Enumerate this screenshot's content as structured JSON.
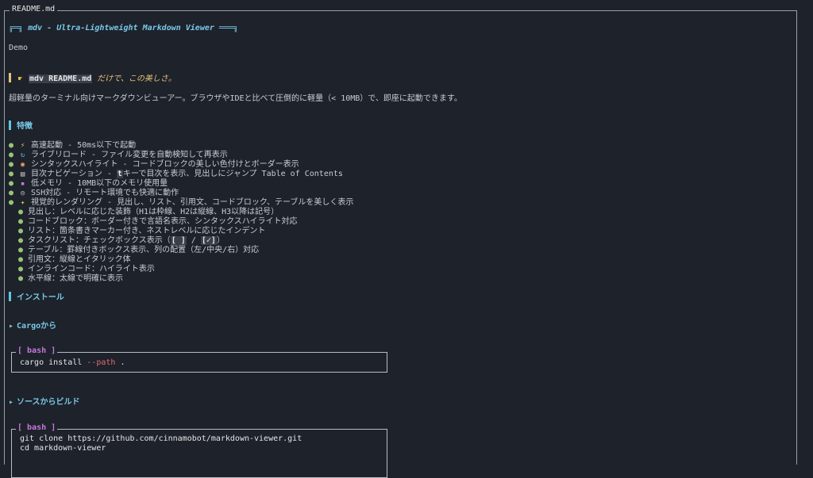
{
  "window": {
    "title": "README.md"
  },
  "h1": {
    "left_rule": "╔═╗",
    "text": "mdv - Ultra-Lightweight Markdown Viewer",
    "right_rule": "═══╗"
  },
  "demo": "Demo",
  "quote": {
    "code": "mdv README.md",
    "text": " だけで、この美しさ。",
    "icon": "pointing-hand"
  },
  "intro": "超軽量のターミナル向けマークダウンビューアー。ブラウザやIDEと比べて圧倒的に軽量（< 10MB）で、即座に起動できます。",
  "features": {
    "heading": "特徴",
    "items": [
      {
        "icon": "⚡",
        "icon_name": "lightning-icon",
        "text": "高速起動 - 50ms以下で起動"
      },
      {
        "icon": "↻",
        "icon_name": "reload-icon",
        "text": "ライブリロード - ファイル変更を自動検知して再表示"
      },
      {
        "icon": "◉",
        "icon_name": "palette-icon",
        "text": "シンタックスハイライト - コードブロックの美しい色付けとボーダー表示"
      },
      {
        "icon": "▤",
        "icon_name": "page-icon",
        "text_before": "目次ナビゲーション - ",
        "key": "t",
        "text_after": "キーで目次を表示、見出しにジャンプ Table of Contents"
      },
      {
        "icon": "▪",
        "icon_name": "floppy-icon",
        "text": "低メモリ - 10MB以下のメモリ使用量"
      },
      {
        "icon": "◎",
        "icon_name": "globe-icon",
        "text": "SSH対応 - リモート環境でも快適に動作"
      },
      {
        "icon": "✦",
        "icon_name": "sparkles-icon",
        "text": "視覚的レンダリング - 見出し、リスト、引用文、コードブロック、テーブルを美しく表示"
      }
    ],
    "sub_items": [
      "見出し：レベルに応じた装飾（H1は枠線、H2は縦線、H3以降は記号）",
      "コードブロック：ボーダー付きで言語名表示、シンタックスハイライト対応",
      "リスト：箇条書きマーカー付き、ネストレベルに応じたインデント",
      "引用文：縦線とイタリック体",
      "インラインコード：ハイライト表示",
      "水平線：太線で明確に表示"
    ],
    "tasklist": {
      "before": "タスクリスト：チェックボックス表示（",
      "unchecked": "[ ]",
      "sep": " / ",
      "checked": "[✓]",
      "after": "）"
    },
    "table_item": "テーブル：罫線付きボックス表示、列の配置（左/中央/右）対応"
  },
  "install": {
    "heading": "インストール",
    "cargo_heading": "Cargoから",
    "cargo_code": {
      "lang": "bash",
      "cmd": "cargo install ",
      "flag": "--path",
      "rest": " ."
    },
    "source_heading": "ソースからビルド",
    "source_code": {
      "lang": "bash",
      "lines": [
        "git clone https://github.com/cinnamobot/markdown-viewer.git",
        "cd markdown-viewer"
      ]
    }
  },
  "colors": {
    "background": "#1e222a",
    "heading": "#78c8e8",
    "quote": "#e5c07b",
    "bullet": "#98c379",
    "code_lang": "#c678dd",
    "flag": "#e06c75"
  }
}
